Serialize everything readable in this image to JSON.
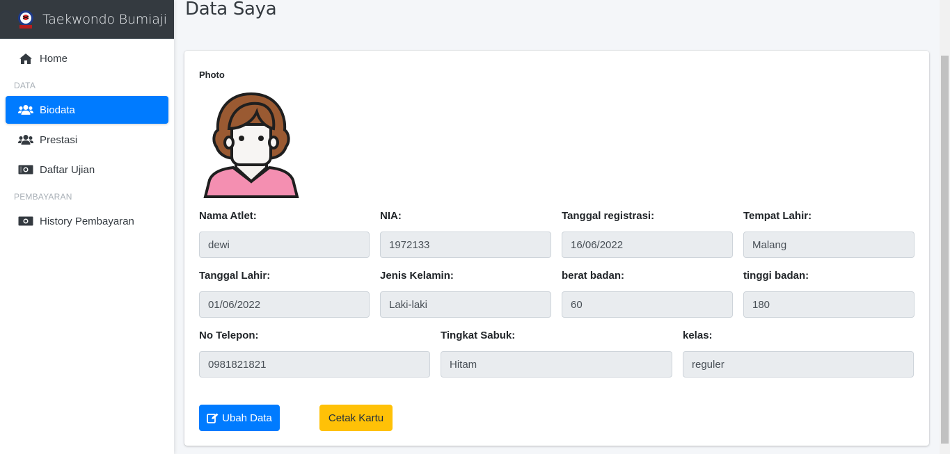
{
  "brand": {
    "name": "Taekwondo Bumiaji",
    "logo_icon": "taekwondo-logo"
  },
  "sidebar": {
    "items": [
      {
        "label": "Home",
        "icon": "home-icon"
      },
      {
        "header": "DATA"
      },
      {
        "label": "Biodata",
        "icon": "users-icon",
        "active": true
      },
      {
        "label": "Prestasi",
        "icon": "users-icon"
      },
      {
        "label": "Daftar Ujian",
        "icon": "money-bill-icon"
      },
      {
        "header": "PEMBAYARAN"
      },
      {
        "label": "History Pembayaran",
        "icon": "money-bill-icon"
      }
    ],
    "active_color": "#007bff"
  },
  "page": {
    "title": "Data Saya"
  },
  "card": {
    "photo_label": "Photo",
    "fields": {
      "nama_atlet": {
        "label": "Nama Atlet:",
        "value": "dewi"
      },
      "nia": {
        "label": "NIA:",
        "value": "1972133"
      },
      "tanggal_registrasi": {
        "label": "Tanggal registrasi:",
        "value": "16/06/2022"
      },
      "tempat_lahir": {
        "label": "Tempat Lahir:",
        "value": "Malang"
      },
      "tanggal_lahir": {
        "label": "Tanggal Lahir:",
        "value": "01/06/2022"
      },
      "jenis_kelamin": {
        "label": "Jenis Kelamin:",
        "value": "Laki-laki"
      },
      "berat_badan": {
        "label": "berat badan:",
        "value": "60"
      },
      "tinggi_badan": {
        "label": "tinggi badan:",
        "value": "180"
      },
      "no_telepon": {
        "label": "No Telepon:",
        "value": "0981821821"
      },
      "tingkat_sabuk": {
        "label": "Tingkat Sabuk:",
        "value": "Hitam"
      },
      "kelas": {
        "label": "kelas:",
        "value": "reguler"
      }
    },
    "buttons": {
      "edit": {
        "label": "Ubah Data",
        "icon": "edit-icon",
        "color": "#007bff"
      },
      "print": {
        "label": "Cetak Kartu",
        "color": "#ffc107"
      }
    }
  }
}
